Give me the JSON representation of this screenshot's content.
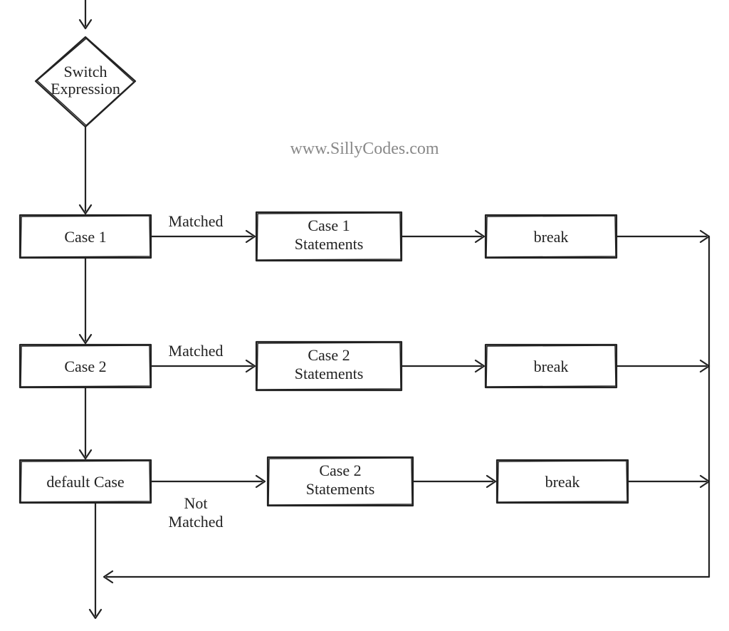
{
  "watermark": "www.SillyCodes.com",
  "nodes": {
    "switch_expr": {
      "line1": "Switch",
      "line2": "Expression"
    },
    "case1": {
      "label": "Case 1"
    },
    "case2": {
      "label": "Case 2"
    },
    "default": {
      "label": "default Case"
    },
    "case1_stmts": {
      "line1": "Case 1",
      "line2": "Statements"
    },
    "case2_stmts": {
      "line1": "Case 2",
      "line2": "Statements"
    },
    "case3_stmts": {
      "line1": "Case 2",
      "line2": "Statements"
    },
    "break1": {
      "label": "break"
    },
    "break2": {
      "label": "break"
    },
    "break3": {
      "label": "break"
    }
  },
  "edge_labels": {
    "case1_matched": "Matched",
    "case2_matched": "Matched",
    "default_not_matched_l1": "Not",
    "default_not_matched_l2": "Matched"
  }
}
